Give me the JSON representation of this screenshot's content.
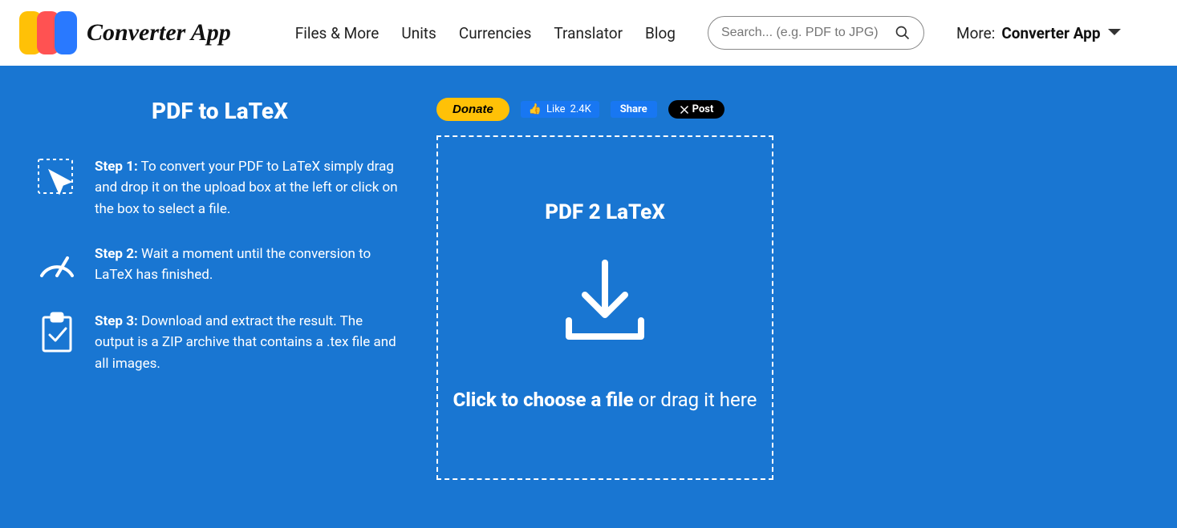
{
  "header": {
    "logo_text": "Converter App",
    "nav": [
      "Files & More",
      "Units",
      "Currencies",
      "Translator",
      "Blog"
    ],
    "search_placeholder": "Search... (e.g. PDF to JPG)",
    "more_label": "More:",
    "more_app": "Converter App"
  },
  "page": {
    "title": "PDF to LaTeX",
    "steps": [
      {
        "label": "Step 1:",
        "text": "To convert your PDF to LaTeX simply drag and drop it on the upload box at the left or click on the box to select a file."
      },
      {
        "label": "Step 2:",
        "text": "Wait a moment until the conversion to LaTeX has finished."
      },
      {
        "label": "Step 3:",
        "text": "Download and extract the result. The output is a ZIP archive that contains a .tex file and all images."
      }
    ]
  },
  "social": {
    "donate": "Donate",
    "like": "Like",
    "like_count": "2.4K",
    "share": "Share",
    "post": "Post"
  },
  "dropzone": {
    "title": "PDF 2 LaTeX",
    "main_text": "Click to choose a file",
    "sub_text": "or drag it here"
  },
  "colors": {
    "brand_blue": "#1976d2"
  }
}
